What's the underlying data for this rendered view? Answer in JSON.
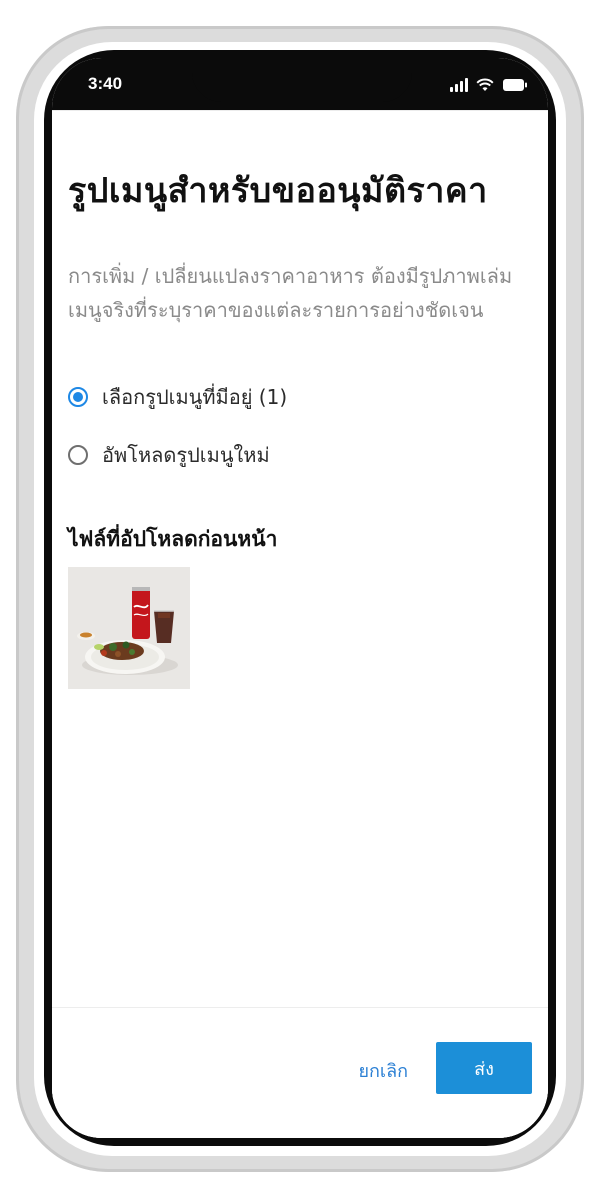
{
  "status_bar": {
    "time": "3:40",
    "icons": [
      "signal-icon",
      "wifi-icon",
      "battery-icon"
    ]
  },
  "header": {
    "title": "รูปเมนูสำหรับขออนุมัติราคา"
  },
  "description": "การเพิ่ม / เปลี่ยนแปลงราคาอาหาร ต้องมีรูปภาพเล่มเมนูจริงที่ระบุราคาของแต่ละรายการอย่างชัดเจน",
  "options": [
    {
      "label": "เลือกรูปเมนูที่มีอยู่ (1)",
      "selected": true
    },
    {
      "label": "อัพโหลดรูปเมนูใหม่",
      "selected": false
    }
  ],
  "uploaded": {
    "section_title": "ไฟล์ที่อัปโหลดก่อนหน้า",
    "files_shown": 1
  },
  "footer": {
    "cancel_label": "ยกเลิก",
    "submit_label": "ส่ง"
  },
  "colors": {
    "accent": "#1c8fd8",
    "radio_selected": "#1e88e5",
    "description_text": "#8a8a8a"
  }
}
